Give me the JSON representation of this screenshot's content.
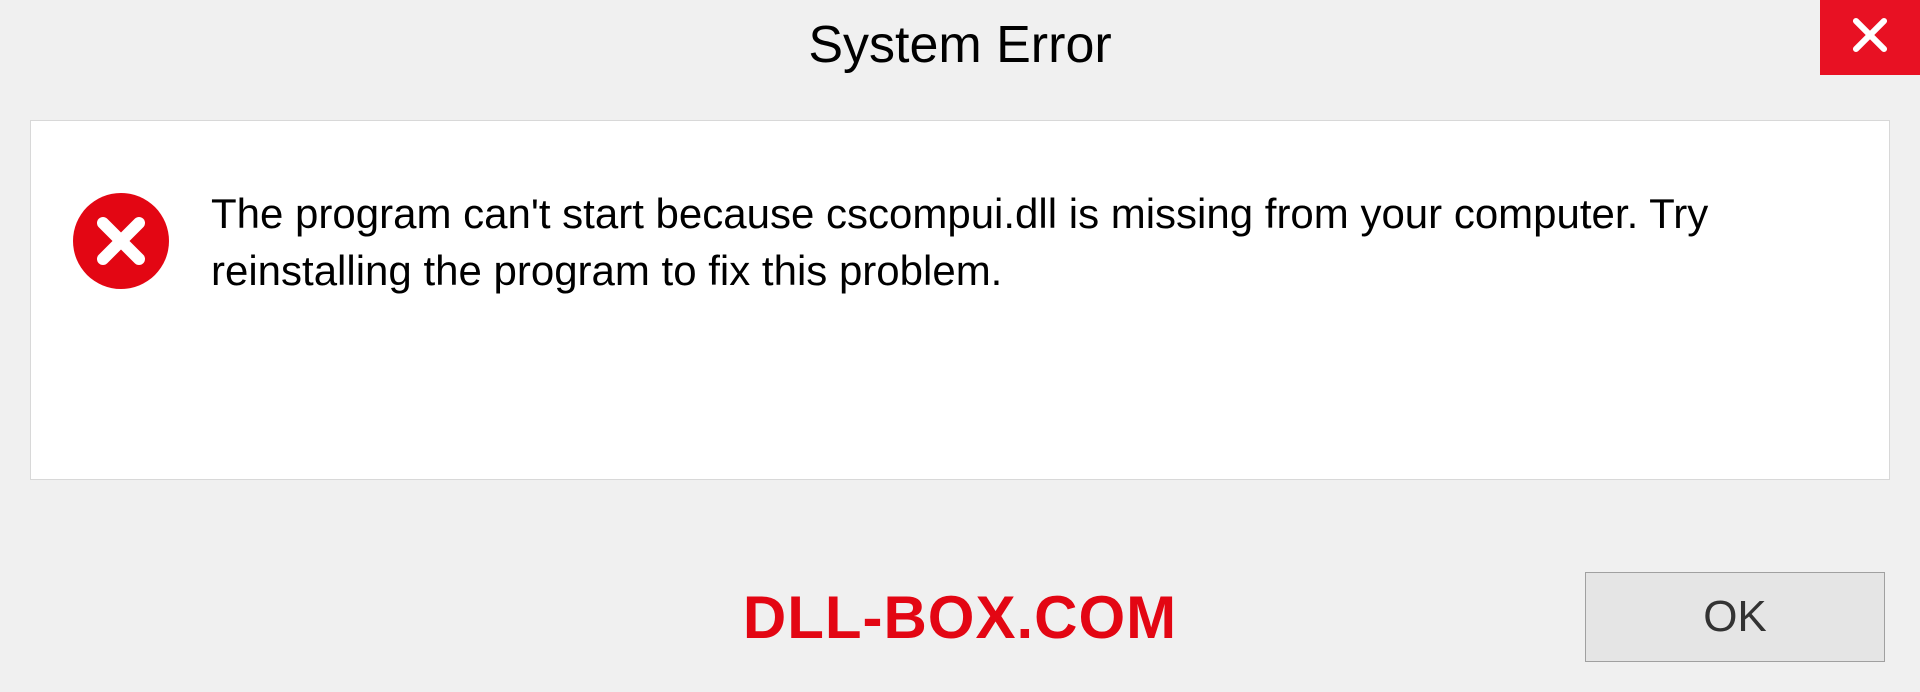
{
  "dialog": {
    "title": "System Error",
    "message": "The program can't start because cscompui.dll is missing from your computer. Try reinstalling the program to fix this problem.",
    "ok_label": "OK"
  },
  "watermark": "DLL-BOX.COM"
}
